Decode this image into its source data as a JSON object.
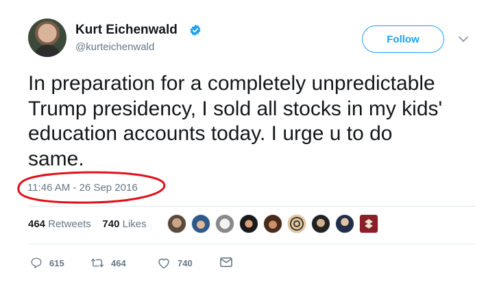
{
  "user": {
    "name": "Kurt Eichenwald",
    "handle": "@kurteichenwald",
    "follow_label": "Follow"
  },
  "tweet": {
    "line1": "In preparation for a completely unpredictable",
    "line2": "Trump presidency, I sold all stocks in my kids'",
    "line3": "education accounts today. I urge u to do",
    "line4": "same.",
    "timestamp": "11:46 AM - 26 Sep 2016"
  },
  "stats": {
    "retweets_count": "464",
    "retweets_label": "Retweets",
    "likes_count": "740",
    "likes_label": "Likes"
  },
  "actions": {
    "reply_count": "615",
    "retweet_count": "464",
    "like_count": "740"
  },
  "colors": {
    "accent": "#1da1f2",
    "annotation": "#e0101a",
    "muted": "#657786"
  },
  "icons": [
    "verified-badge-icon",
    "chevron-down-icon",
    "reply-icon",
    "retweet-icon",
    "heart-icon",
    "message-icon"
  ]
}
